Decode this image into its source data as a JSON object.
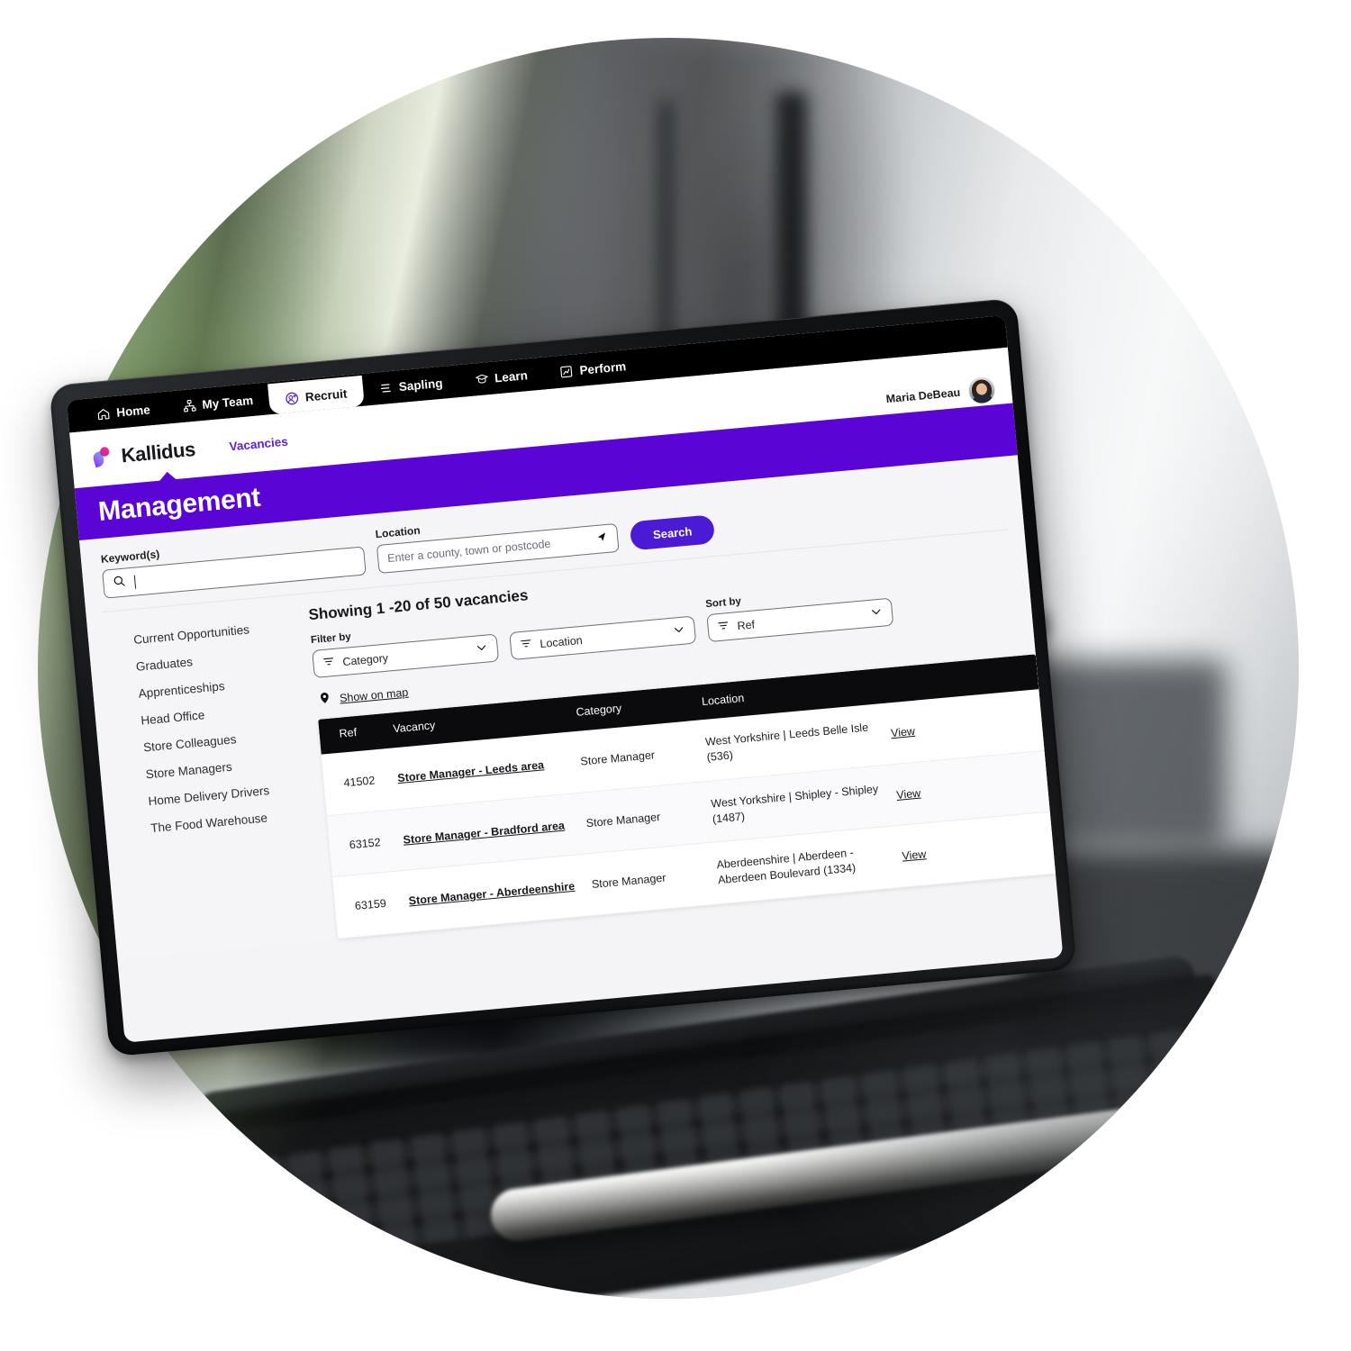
{
  "app_nav": {
    "items": [
      {
        "label": "Home",
        "icon": "home-icon",
        "active": false
      },
      {
        "label": "My Team",
        "icon": "org-chart-icon",
        "active": false
      },
      {
        "label": "Recruit",
        "icon": "recruit-badge-icon",
        "active": true
      },
      {
        "label": "Sapling",
        "icon": "sapling-icon",
        "active": false
      },
      {
        "label": "Learn",
        "icon": "graduation-cap-icon",
        "active": false
      },
      {
        "label": "Perform",
        "icon": "chart-icon",
        "active": false
      }
    ]
  },
  "brand": {
    "name": "Kallidus",
    "logo_icon": "kallidus-logo-icon"
  },
  "product_nav": {
    "items": [
      {
        "label": "Vacancies",
        "active": true
      }
    ]
  },
  "user": {
    "name": "Maria DeBeau",
    "avatar_icon": "avatar"
  },
  "banner": {
    "title": "Management",
    "color": "#5a04d6"
  },
  "search": {
    "keyword_label": "Keyword(s)",
    "keyword_value": "",
    "keyword_icon": "search-icon",
    "location_label": "Location",
    "location_placeholder": "Enter a county, town or postcode",
    "location_icon": "location-arrow-icon",
    "button_label": "Search",
    "button_color": "#4a1ad4"
  },
  "sidebar": {
    "items": [
      {
        "label": "Current Opportunities"
      },
      {
        "label": "Graduates"
      },
      {
        "label": "Apprenticeships"
      },
      {
        "label": "Head Office"
      },
      {
        "label": "Store Colleagues"
      },
      {
        "label": "Store Managers"
      },
      {
        "label": "Home Delivery Drivers"
      },
      {
        "label": "The Food Warehouse"
      }
    ]
  },
  "results": {
    "showing": "Showing 1 -20 of 50 vacancies",
    "filter_by_label": "Filter by",
    "sort_by_label": "Sort by",
    "filters": [
      {
        "label": "Category",
        "icon": "filter-icon"
      },
      {
        "label": "Location",
        "icon": "filter-icon"
      }
    ],
    "sort": {
      "label": "Ref",
      "icon": "filter-icon"
    },
    "map_link": {
      "label": "Show on map",
      "icon": "map-pin-icon"
    }
  },
  "table": {
    "columns": [
      "Ref",
      "Vacancy",
      "Category",
      "Location"
    ],
    "action_label": "View",
    "rows": [
      {
        "ref": "41502",
        "vacancy": "Store Manager - Leeds area",
        "category": "Store Manager",
        "location": "West Yorkshire | Leeds Belle Isle (536)",
        "action": "View"
      },
      {
        "ref": "63152",
        "vacancy": "Store Manager - Bradford area",
        "category": "Store Manager",
        "location": "West Yorkshire | Shipley - Shipley (1487)",
        "action": "View"
      },
      {
        "ref": "63159",
        "vacancy": "Store Manager - Aberdeenshire",
        "category": "Store Manager",
        "location": "Aberdeenshire | Aberdeen - Aberdeen Boulevard (1334)",
        "action": "View"
      }
    ]
  }
}
